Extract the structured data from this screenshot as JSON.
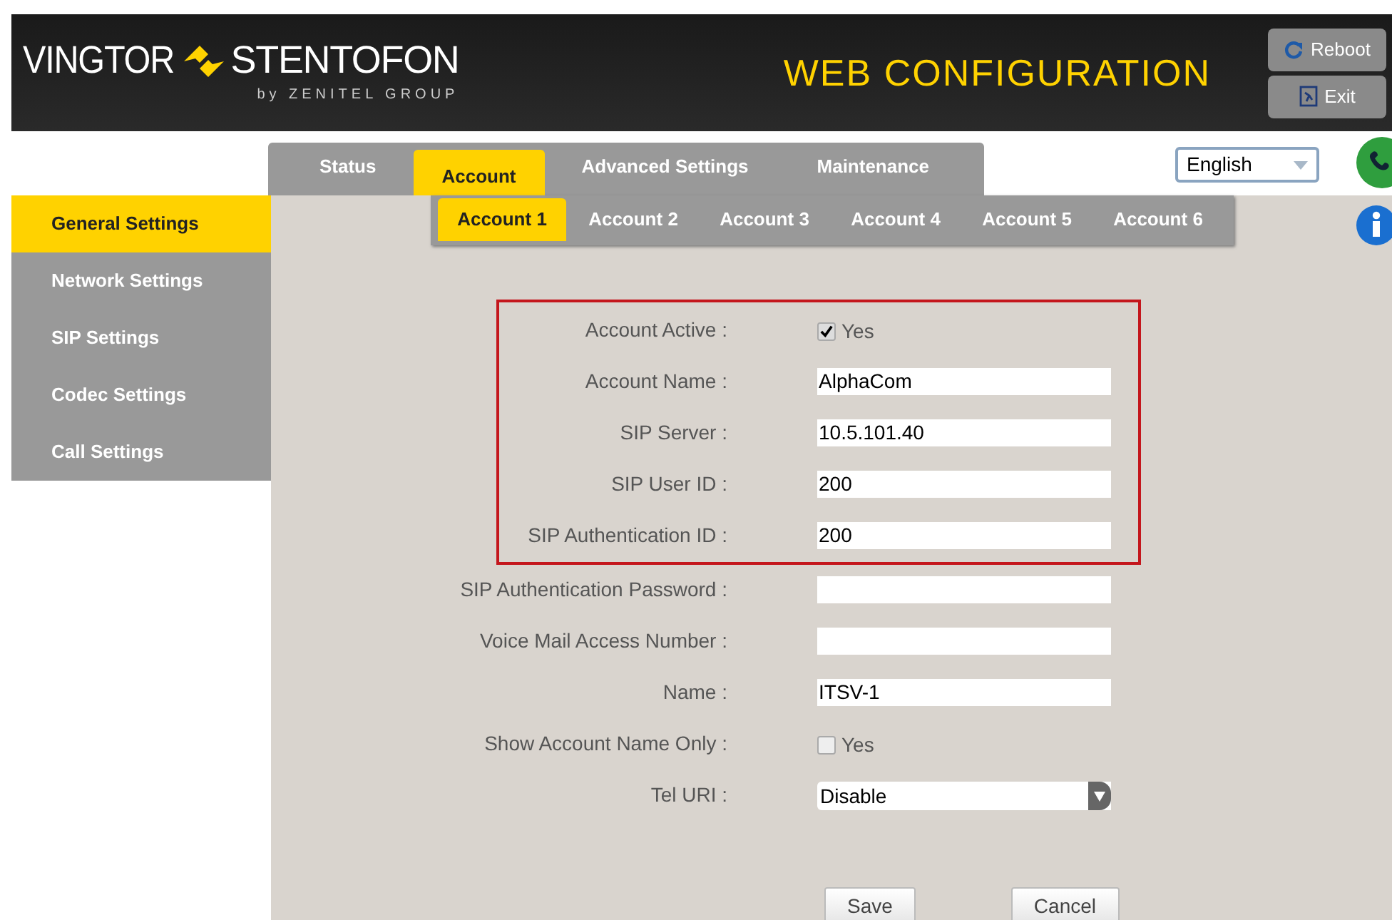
{
  "header": {
    "logo_left": "VINGTOR",
    "logo_right": "STENTOFON",
    "logo_sub": "by ZENITEL GROUP",
    "title": "WEB CONFIGURATION",
    "buttons": [
      {
        "label": "Reboot",
        "kind": "reboot"
      },
      {
        "label": "Exit",
        "kind": "exit"
      }
    ]
  },
  "tabs": [
    {
      "label": "Status",
      "selected": false
    },
    {
      "label": "Account",
      "selected": true
    },
    {
      "label": "Advanced Settings",
      "selected": false
    },
    {
      "label": "Maintenance",
      "selected": false
    }
  ],
  "language": {
    "value": "English"
  },
  "sidebar": {
    "items": [
      {
        "label": "General Settings",
        "selected": true
      },
      {
        "label": "Network Settings",
        "selected": false
      },
      {
        "label": "SIP Settings",
        "selected": false
      },
      {
        "label": "Codec Settings",
        "selected": false
      },
      {
        "label": "Call Settings",
        "selected": false
      }
    ]
  },
  "subtabs": [
    {
      "label": "Account 1",
      "selected": true
    },
    {
      "label": "Account 2",
      "selected": false
    },
    {
      "label": "Account 3",
      "selected": false
    },
    {
      "label": "Account 4",
      "selected": false
    },
    {
      "label": "Account 5",
      "selected": false
    },
    {
      "label": "Account 6",
      "selected": false
    }
  ],
  "form": {
    "highlighted_fields": [
      {
        "label": "Account Active :",
        "kind": "checkbox",
        "option": "Yes",
        "checked": true
      },
      {
        "label": "Account Name :",
        "kind": "text",
        "value": "AlphaCom"
      },
      {
        "label": "SIP Server :",
        "kind": "text",
        "value": "10.5.101.40"
      },
      {
        "label": "SIP User ID :",
        "kind": "text",
        "value": "200"
      },
      {
        "label": "SIP Authentication ID :",
        "kind": "text",
        "value": "200"
      }
    ],
    "fields": [
      {
        "label": "SIP Authentication Password :",
        "kind": "text"
      },
      {
        "label": "Voice Mail Access Number :",
        "kind": "text"
      },
      {
        "label": "Name :",
        "kind": "text",
        "value": "ITSV-1"
      },
      {
        "label": "Show Account Name Only :",
        "kind": "checkbox",
        "option": "Yes",
        "checked": false
      },
      {
        "label": "Tel URI :",
        "kind": "select",
        "value": "Disable"
      }
    ],
    "buttons": [
      "Save",
      "Cancel"
    ]
  }
}
